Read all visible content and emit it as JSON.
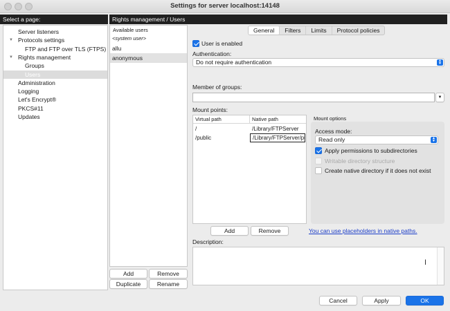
{
  "window": {
    "title": "Settings for server localhost:14148"
  },
  "left_panel": {
    "header": "Select a page:",
    "tree": [
      {
        "label": "Server listeners",
        "level": 0,
        "expandable": false,
        "selected": false
      },
      {
        "label": "Protocols settings",
        "level": 0,
        "expandable": true,
        "selected": false
      },
      {
        "label": "FTP and FTP over TLS (FTPS)",
        "level": 1,
        "expandable": false,
        "selected": false
      },
      {
        "label": "Rights management",
        "level": 0,
        "expandable": true,
        "selected": false
      },
      {
        "label": "Groups",
        "level": 1,
        "expandable": false,
        "selected": false
      },
      {
        "label": "Users",
        "level": 1,
        "expandable": false,
        "selected": true
      },
      {
        "label": "Administration",
        "level": 0,
        "expandable": false,
        "selected": false
      },
      {
        "label": "Logging",
        "level": 0,
        "expandable": false,
        "selected": false
      },
      {
        "label": "Let's Encrypt®",
        "level": 0,
        "expandable": false,
        "selected": false
      },
      {
        "label": "PKCS#11",
        "level": 0,
        "expandable": false,
        "selected": false
      },
      {
        "label": "Updates",
        "level": 0,
        "expandable": false,
        "selected": false
      }
    ]
  },
  "right_panel": {
    "header": "Rights management / Users"
  },
  "users": {
    "header": "Available users",
    "items": [
      {
        "label": "<system user>",
        "italic": true,
        "selected": false
      },
      {
        "label": "allu",
        "italic": false,
        "selected": false
      },
      {
        "label": "anonymous",
        "italic": false,
        "selected": true
      }
    ],
    "buttons": {
      "add": "Add",
      "remove": "Remove",
      "duplicate": "Duplicate",
      "rename": "Rename"
    }
  },
  "tabs": [
    {
      "label": "General",
      "active": true
    },
    {
      "label": "Filters",
      "active": false
    },
    {
      "label": "Limits",
      "active": false
    },
    {
      "label": "Protocol policies",
      "active": false
    }
  ],
  "general": {
    "user_enabled_label": "User is enabled",
    "user_enabled": true,
    "authentication_label": "Authentication:",
    "authentication_value": "Do not require authentication",
    "member_of_groups_label": "Member of groups:",
    "member_of_groups_value": "",
    "mount_points_label": "Mount points:",
    "mount_table": {
      "columns": [
        "Virtual path",
        "Native path"
      ],
      "rows": [
        {
          "virtual": "/",
          "native": "/Library/FTPServer"
        },
        {
          "virtual": "/public",
          "native": "/Library/FTPServer/public"
        }
      ]
    },
    "mount_add": "Add",
    "mount_remove": "Remove",
    "placeholders_link": "You can use placeholders in native paths.",
    "mount_options": {
      "title": "Mount options",
      "access_mode_label": "Access mode:",
      "access_mode_value": "Read only",
      "apply_permissions_label": "Apply permissions to subdirectories",
      "apply_permissions": true,
      "writable_structure_label": "Writable directory structure",
      "writable_structure": false,
      "create_native_label": "Create native directory if it does not exist",
      "create_native": false
    },
    "description_label": "Description:",
    "description_value": ""
  },
  "footer": {
    "cancel": "Cancel",
    "apply": "Apply",
    "ok": "OK"
  },
  "colors": {
    "accent": "#1a73e8",
    "header_bg": "#202020",
    "link": "#1a3cc8"
  }
}
